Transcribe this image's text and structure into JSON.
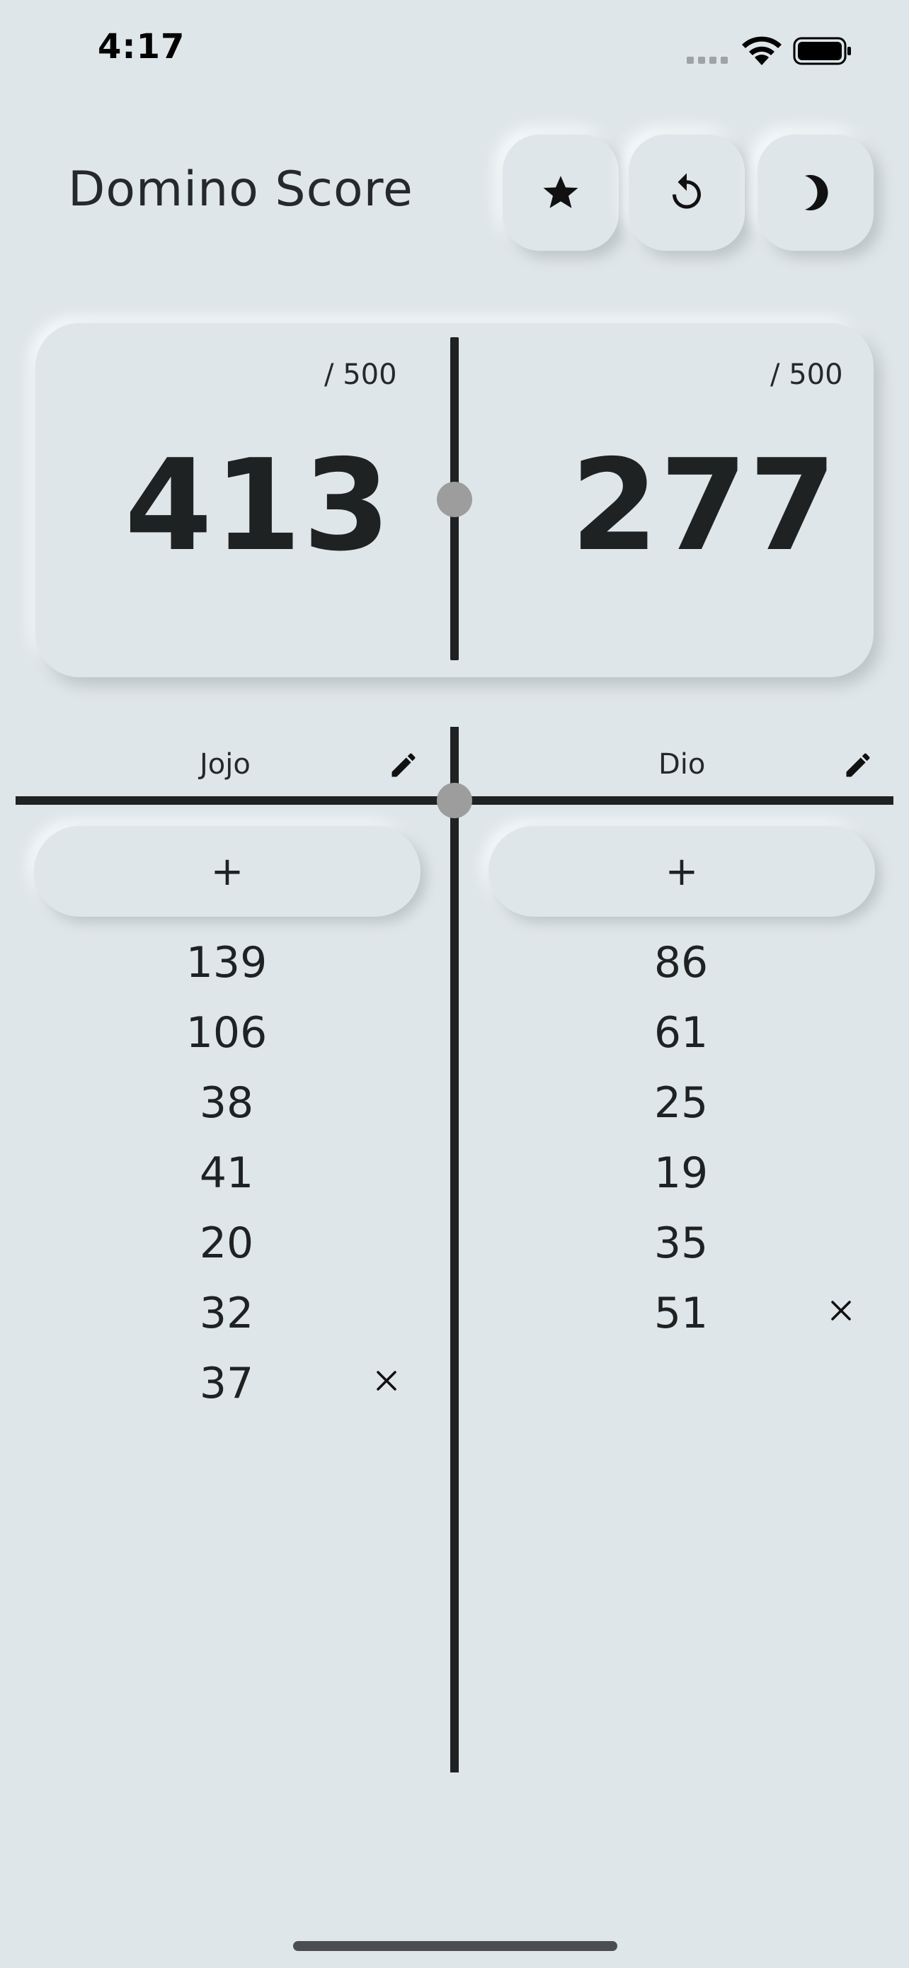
{
  "status_bar": {
    "time": "4:17",
    "icons": [
      "signal-icon",
      "wifi-icon",
      "battery-icon"
    ]
  },
  "header": {
    "title": "Domino Score",
    "buttons": [
      {
        "name": "favorite-button",
        "icon": "star-icon"
      },
      {
        "name": "reset-button",
        "icon": "restart-icon"
      },
      {
        "name": "theme-button",
        "icon": "moon-icon"
      }
    ]
  },
  "scoreboard": {
    "left": {
      "total": "413",
      "target": "/ 500"
    },
    "right": {
      "total": "277",
      "target": "/ 500"
    }
  },
  "players": [
    {
      "name": "Jojo",
      "add_label": "+",
      "scores": [
        "139",
        "106",
        "38",
        "41",
        "20",
        "32",
        "37"
      ]
    },
    {
      "name": "Dio",
      "add_label": "+",
      "scores": [
        "86",
        "61",
        "25",
        "19",
        "35",
        "51"
      ]
    }
  ],
  "colors": {
    "background": "#dfe6e9",
    "text": "#1f2223",
    "accent_dot": "#9d9d9d"
  }
}
